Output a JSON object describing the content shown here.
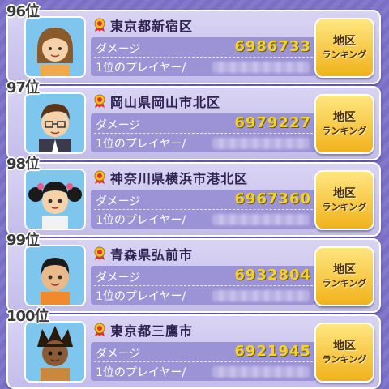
{
  "rows": [
    {
      "rank": "96位",
      "prefecture": "東京都新宿区",
      "damage_label": "ダメージ",
      "damage": "6986733",
      "player_label": "1位のプレイヤー/",
      "button_line1": "地区",
      "button_line2": "ランキング",
      "avatar": "female-teacher-avatar"
    },
    {
      "rank": "97位",
      "prefecture": "岡山県岡山市北区",
      "damage_label": "ダメージ",
      "damage": "6979227",
      "player_label": "1位のプレイヤー/",
      "button_line1": "地区",
      "button_line2": "ランキング",
      "avatar": "glasses-man-avatar"
    },
    {
      "rank": "98位",
      "prefecture": "神奈川県横浜市港北区",
      "damage_label": "ダメージ",
      "damage": "6967360",
      "player_label": "1位のプレイヤー/",
      "button_line1": "地区",
      "button_line2": "ランキング",
      "avatar": "twin-tail-girl-avatar"
    },
    {
      "rank": "99位",
      "prefecture": "青森県弘前市",
      "damage_label": "ダメージ",
      "damage": "6932804",
      "player_label": "1位のプレイヤー/",
      "button_line1": "地区",
      "button_line2": "ランキング",
      "avatar": "boy-avatar"
    },
    {
      "rank": "100位",
      "prefecture": "東京都三鷹市",
      "damage_label": "ダメージ",
      "damage": "6921945",
      "player_label": "1位のプレイヤー/",
      "button_line1": "地区",
      "button_line2": "ランキング",
      "avatar": "spiky-hair-boy-avatar"
    }
  ],
  "colors": {
    "accent": "#f0b21c",
    "damage": "#f5d22a",
    "panel": "#9c92d6"
  }
}
